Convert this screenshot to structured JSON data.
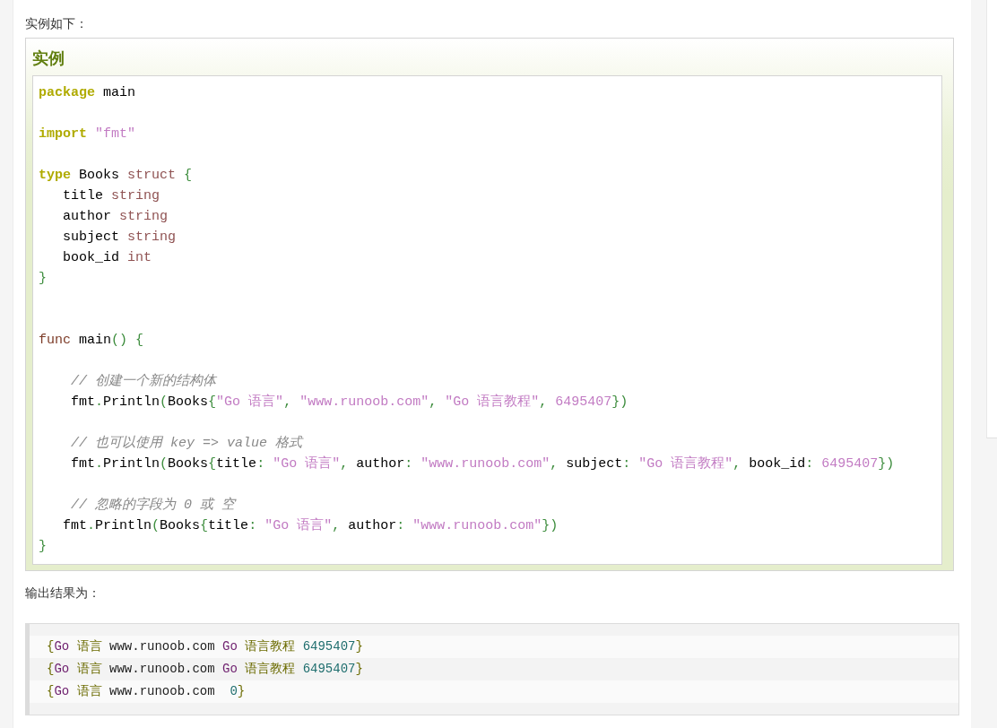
{
  "intro": "实例如下：",
  "example": {
    "title": "实例",
    "lines": [
      {
        "kind": "code",
        "tokens": [
          {
            "kind": "keyword",
            "text": "package"
          },
          {
            "kind": "plain",
            "text": " main"
          }
        ]
      },
      {
        "kind": "blank"
      },
      {
        "kind": "code",
        "tokens": [
          {
            "kind": "keyword",
            "text": "import"
          },
          {
            "kind": "string",
            "text": " \"fmt\""
          }
        ]
      },
      {
        "kind": "blank"
      },
      {
        "kind": "code",
        "tokens": [
          {
            "kind": "keyword",
            "text": "type"
          },
          {
            "kind": "plain",
            "text": " Books "
          },
          {
            "kind": "type",
            "text": "struct"
          },
          {
            "kind": "punctuation",
            "text": " {"
          }
        ]
      },
      {
        "kind": "code",
        "tokens": [
          {
            "kind": "plain",
            "text": "   title "
          },
          {
            "kind": "type",
            "text": "string"
          }
        ]
      },
      {
        "kind": "code",
        "tokens": [
          {
            "kind": "plain",
            "text": "   author "
          },
          {
            "kind": "type",
            "text": "string"
          }
        ]
      },
      {
        "kind": "code",
        "tokens": [
          {
            "kind": "plain",
            "text": "   subject "
          },
          {
            "kind": "type",
            "text": "string"
          }
        ]
      },
      {
        "kind": "code",
        "tokens": [
          {
            "kind": "plain",
            "text": "   book_id "
          },
          {
            "kind": "type",
            "text": "int"
          }
        ]
      },
      {
        "kind": "code",
        "tokens": [
          {
            "kind": "punctuation",
            "text": "}"
          }
        ]
      },
      {
        "kind": "blank"
      },
      {
        "kind": "blank"
      },
      {
        "kind": "code",
        "tokens": [
          {
            "kind": "declaration",
            "text": "func"
          },
          {
            "kind": "plain",
            "text": " main"
          },
          {
            "kind": "punctuation",
            "text": "() {"
          }
        ]
      },
      {
        "kind": "blank"
      },
      {
        "kind": "code",
        "tokens": [
          {
            "kind": "comment",
            "text": "    // 创建一个新的结构体"
          }
        ]
      },
      {
        "kind": "code",
        "tokens": [
          {
            "kind": "plain",
            "text": "    fmt"
          },
          {
            "kind": "punctuation",
            "text": "."
          },
          {
            "kind": "plain",
            "text": "Println"
          },
          {
            "kind": "punctuation",
            "text": "("
          },
          {
            "kind": "plain",
            "text": "Books"
          },
          {
            "kind": "punctuation",
            "text": "{"
          },
          {
            "kind": "string",
            "text": "\"Go 语言\""
          },
          {
            "kind": "punctuation",
            "text": ", "
          },
          {
            "kind": "string",
            "text": "\"www.runoob.com\""
          },
          {
            "kind": "punctuation",
            "text": ", "
          },
          {
            "kind": "string",
            "text": "\"Go 语言教程\""
          },
          {
            "kind": "punctuation",
            "text": ", "
          },
          {
            "kind": "number",
            "text": "6495407"
          },
          {
            "kind": "punctuation",
            "text": "})"
          }
        ]
      },
      {
        "kind": "blank"
      },
      {
        "kind": "code",
        "tokens": [
          {
            "kind": "comment",
            "text": "    // 也可以使用 key => value 格式"
          }
        ]
      },
      {
        "kind": "code",
        "tokens": [
          {
            "kind": "plain",
            "text": "    fmt"
          },
          {
            "kind": "punctuation",
            "text": "."
          },
          {
            "kind": "plain",
            "text": "Println"
          },
          {
            "kind": "punctuation",
            "text": "("
          },
          {
            "kind": "plain",
            "text": "Books"
          },
          {
            "kind": "punctuation",
            "text": "{"
          },
          {
            "kind": "plain",
            "text": "title"
          },
          {
            "kind": "punctuation",
            "text": ": "
          },
          {
            "kind": "string",
            "text": "\"Go 语言\""
          },
          {
            "kind": "punctuation",
            "text": ", "
          },
          {
            "kind": "plain",
            "text": "author"
          },
          {
            "kind": "punctuation",
            "text": ": "
          },
          {
            "kind": "string",
            "text": "\"www.runoob.com\""
          },
          {
            "kind": "punctuation",
            "text": ", "
          },
          {
            "kind": "plain",
            "text": "subject"
          },
          {
            "kind": "punctuation",
            "text": ": "
          },
          {
            "kind": "string",
            "text": "\"Go 语言教程\""
          },
          {
            "kind": "punctuation",
            "text": ", "
          },
          {
            "kind": "plain",
            "text": "book_id"
          },
          {
            "kind": "punctuation",
            "text": ": "
          },
          {
            "kind": "number",
            "text": "6495407"
          },
          {
            "kind": "punctuation",
            "text": "})"
          }
        ]
      },
      {
        "kind": "blank"
      },
      {
        "kind": "code",
        "tokens": [
          {
            "kind": "comment",
            "text": "    // 忽略的字段为 0 或 空"
          }
        ]
      },
      {
        "kind": "code",
        "tokens": [
          {
            "kind": "plain",
            "text": "   fmt"
          },
          {
            "kind": "punctuation",
            "text": "."
          },
          {
            "kind": "plain",
            "text": "Println"
          },
          {
            "kind": "punctuation",
            "text": "("
          },
          {
            "kind": "plain",
            "text": "Books"
          },
          {
            "kind": "punctuation",
            "text": "{"
          },
          {
            "kind": "plain",
            "text": "title"
          },
          {
            "kind": "punctuation",
            "text": ": "
          },
          {
            "kind": "string",
            "text": "\"Go 语言\""
          },
          {
            "kind": "punctuation",
            "text": ", "
          },
          {
            "kind": "plain",
            "text": "author"
          },
          {
            "kind": "punctuation",
            "text": ": "
          },
          {
            "kind": "string",
            "text": "\"www.runoob.com\""
          },
          {
            "kind": "punctuation",
            "text": "})"
          }
        ]
      },
      {
        "kind": "code",
        "tokens": [
          {
            "kind": "punctuation",
            "text": "}"
          }
        ]
      }
    ]
  },
  "output_caption": "输出结果为：",
  "output": {
    "lines": [
      {
        "tokens": [
          {
            "kind": "punctuation",
            "text": "{"
          },
          {
            "kind": "identifier",
            "text": "Go"
          },
          {
            "kind": "word",
            "text": " 语言"
          },
          {
            "kind": "plain",
            "text": " www.runoob.com "
          },
          {
            "kind": "identifier",
            "text": "Go"
          },
          {
            "kind": "word",
            "text": " 语言教程"
          },
          {
            "kind": "literal",
            "text": " 6495407"
          },
          {
            "kind": "punctuation",
            "text": "}"
          }
        ]
      },
      {
        "tokens": [
          {
            "kind": "punctuation",
            "text": "{"
          },
          {
            "kind": "identifier",
            "text": "Go"
          },
          {
            "kind": "word",
            "text": " 语言"
          },
          {
            "kind": "plain",
            "text": " www.runoob.com "
          },
          {
            "kind": "identifier",
            "text": "Go"
          },
          {
            "kind": "word",
            "text": " 语言教程"
          },
          {
            "kind": "literal",
            "text": " 6495407"
          },
          {
            "kind": "punctuation",
            "text": "}"
          }
        ]
      },
      {
        "tokens": [
          {
            "kind": "punctuation",
            "text": "{"
          },
          {
            "kind": "identifier",
            "text": "Go"
          },
          {
            "kind": "word",
            "text": " 语言"
          },
          {
            "kind": "plain",
            "text": " www.runoob.com  "
          },
          {
            "kind": "literal",
            "text": "0"
          },
          {
            "kind": "punctuation",
            "text": "}"
          }
        ]
      }
    ]
  }
}
